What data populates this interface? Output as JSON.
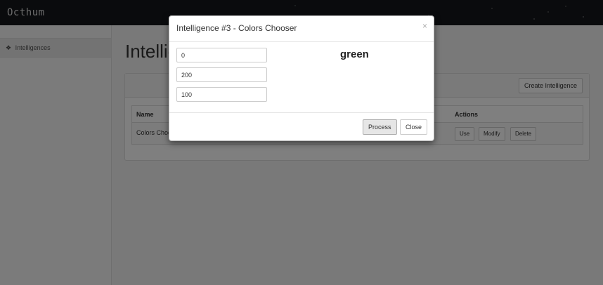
{
  "app": {
    "brand": "Octhum"
  },
  "sidebar": {
    "items": [
      {
        "label": "Intelligences",
        "icon": "cubes-icon"
      }
    ]
  },
  "main": {
    "title": "Intelligences",
    "create_button": "Create Intelligence",
    "table": {
      "headers": {
        "name": "Name",
        "actions": "Actions"
      },
      "rows": [
        {
          "name": "Colors Chooser",
          "actions": [
            "Use",
            "Modify",
            "Delete"
          ]
        }
      ]
    }
  },
  "modal": {
    "title": "Intelligence #3 - Colors Chooser",
    "close_symbol": "×",
    "inputs": [
      "0",
      "200",
      "100"
    ],
    "result": "green",
    "process_button": "Process",
    "close_button": "Close"
  }
}
